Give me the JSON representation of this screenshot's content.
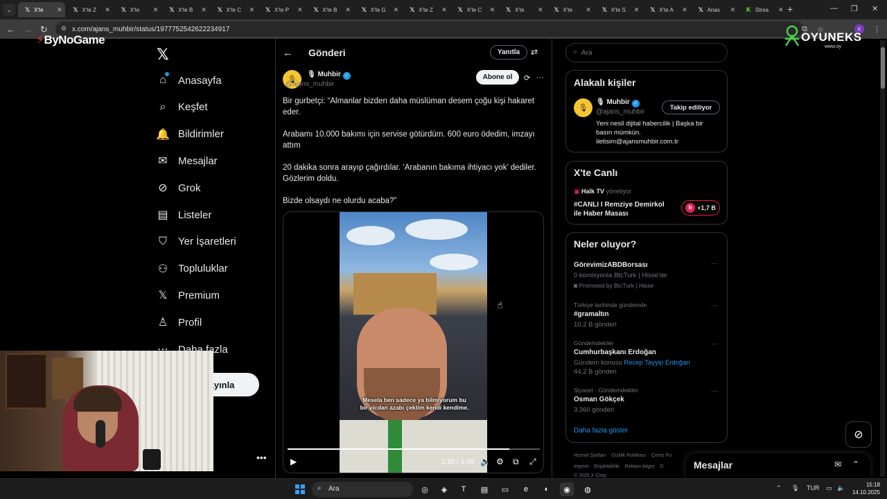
{
  "browser": {
    "tabs": [
      {
        "label": "X'te ",
        "active": true
      },
      {
        "label": "X'te Z"
      },
      {
        "label": "X'te "
      },
      {
        "label": "X'te B"
      },
      {
        "label": "X'te C"
      },
      {
        "label": "X'te P"
      },
      {
        "label": "X'te B"
      },
      {
        "label": "X'te G"
      },
      {
        "label": "X'te Z"
      },
      {
        "label": "X'te C"
      },
      {
        "label": "X'te "
      },
      {
        "label": "X'te "
      },
      {
        "label": "X'te S"
      },
      {
        "label": "X'te A"
      },
      {
        "label": "Anas"
      },
      {
        "label": "Strea"
      }
    ],
    "url": "x.com/ajans_muhbir/status/1977752542622234917"
  },
  "overlays": {
    "bynogame": "ByNoGame",
    "oyuneks": "OYUNEKS",
    "oyuneks_sub": "www.oy"
  },
  "sidebar": {
    "items": [
      {
        "label": "Anasayfa",
        "icon": "home-icon"
      },
      {
        "label": "Keşfet",
        "icon": "search-icon"
      },
      {
        "label": "Bildirimler",
        "icon": "bell-icon"
      },
      {
        "label": "Mesajlar",
        "icon": "mail-icon"
      },
      {
        "label": "Grok",
        "icon": "grok-icon"
      },
      {
        "label": "Listeler",
        "icon": "list-icon"
      },
      {
        "label": "Yer İşaretleri",
        "icon": "bookmark-icon"
      },
      {
        "label": "Topluluklar",
        "icon": "communities-icon"
      },
      {
        "label": "Premium",
        "icon": "x-icon"
      },
      {
        "label": "Profil",
        "icon": "profile-icon"
      },
      {
        "label": "Daha fazla",
        "icon": "more-icon"
      }
    ],
    "post_button": "ayınla"
  },
  "post": {
    "header_title": "Gönderi",
    "reply_button": "Yanıtla",
    "author_name": "Muhbir",
    "author_handle": "@ajans_muhbir",
    "subscribe_button": "Abone ol",
    "paragraphs": [
      "Bir gurbetçi: “Almanlar bizden daha müslüman desem çoğu kişi hakaret eder.",
      "Arabamı 10.000 bakımı için servise götürdüm. 600 euro ödedim, imzayı attım",
      "20 dakika sonra arayıp çağırdılar. ‘Arabanın bakıma ihtiyacı yok’ dediler. Gözlerim doldu.",
      "Bizde olsaydı ne olurdu acaba?”"
    ],
    "video": {
      "caption": "Mesela ben sadece ya bilmiyorum bu bir vicdan azabı çektim kendi kendime.",
      "time": "1:35 / 1:48",
      "progress": 0.88
    }
  },
  "right": {
    "search_placeholder": "Ara",
    "related": {
      "title": "Alakalı kişiler",
      "name": "Muhbir",
      "handle": "@ajans_muhbir",
      "follow_button": "Takip ediliyor",
      "bio": "Yeni nesil dijital habercilik | Başka bir basın mümkün. iletisim@ajansmuhbir.com.tr"
    },
    "live": {
      "title": "X'te Canlı",
      "source": "Halk TV",
      "source_suffix": "yönetiyor",
      "headline": "#CANLI I Remziye Demirkol ile Haber Masası",
      "count": "+1,7 B"
    },
    "trends": {
      "title": "Neler oluyor?",
      "items": [
        {
          "context": "",
          "name": "GörevimizABDBorsası",
          "sub": "0 komisyonla BtcTurk | Hisse'de",
          "meta": "Promoted by BtcTurk | Hisse"
        },
        {
          "context": "Türkiye tarihinde gündemde",
          "name": "#gramaltın",
          "sub": "10,2 B gönderi",
          "meta": ""
        },
        {
          "context": "Gündemdekiler",
          "name": "Cumhurbaşkanı Erdoğan",
          "sub_prefix": "Gündem konusu ",
          "sub_link": "Recep Tayyip Erdoğan",
          "meta": "44,2 B gönderi"
        },
        {
          "context": "Siyaset · Gündemdekiler",
          "name": "Osman Gökçek",
          "sub": "3.360 gönderi",
          "meta": ""
        }
      ],
      "show_more": "Daha fazla göster"
    },
    "footer": {
      "line1": [
        "Hizmet Şartları",
        "Gizlilik Politikası",
        "Çerez Po"
      ],
      "line2": [
        "Imprint",
        "Erişilebilirlik",
        "Reklam bilgisi",
        "D"
      ],
      "line3": "© 2025 X Corp."
    },
    "messages_dock": "Mesajlar"
  },
  "taskbar": {
    "search_placeholder": "Ara",
    "lang": "TUR",
    "time": "15:18",
    "date": "14.10.2025"
  }
}
